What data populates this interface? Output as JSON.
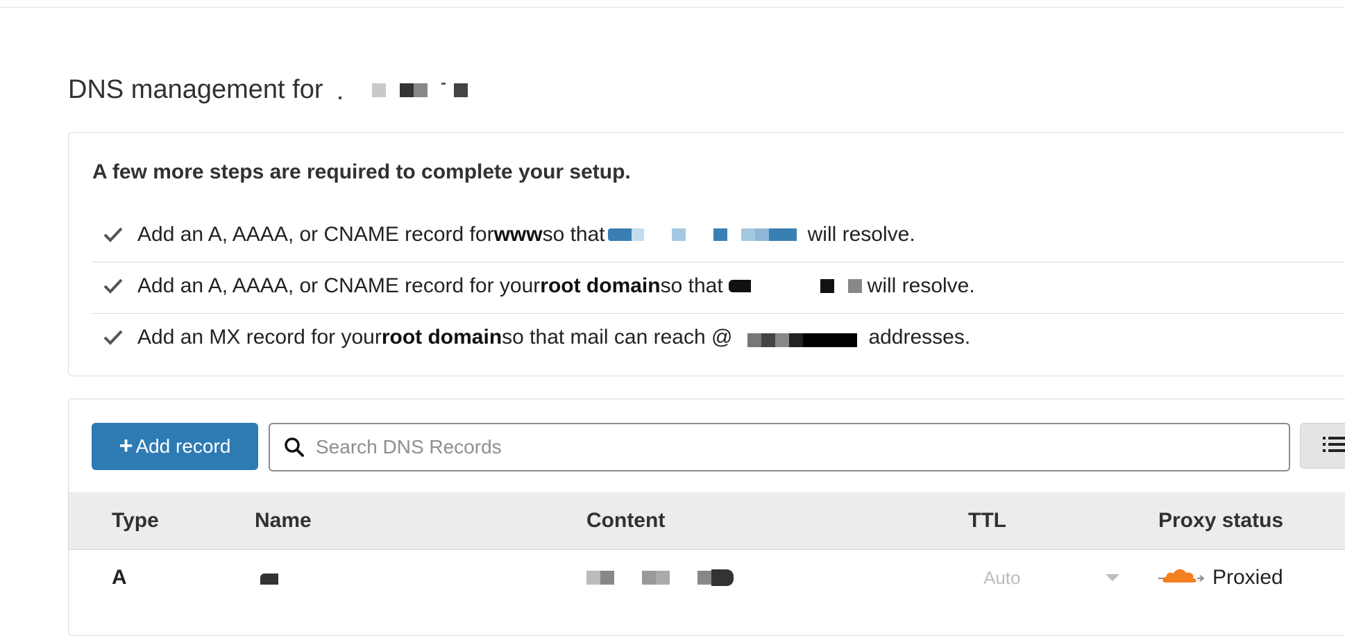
{
  "page": {
    "title": "DNS management for"
  },
  "setup": {
    "heading": "A few more steps are required to complete your setup.",
    "steps": [
      {
        "prefix": "Add an A, AAAA, or CNAME record for ",
        "bold": "www",
        "middle": " so that ",
        "suffix": " will resolve."
      },
      {
        "prefix": "Add an A, AAAA, or CNAME record for your ",
        "bold": "root domain",
        "middle": " so that ",
        "suffix": " will resolve."
      },
      {
        "prefix": "Add an MX record for your ",
        "bold": "root domain",
        "middle": " so that mail can reach @",
        "suffix": " addresses."
      }
    ]
  },
  "toolbar": {
    "add_record_label": "Add record",
    "add_record_icon": "plus-icon",
    "search_placeholder": "Search DNS Records",
    "search_value": "",
    "search_icon": "search-icon",
    "view_toggle_icon": "list-icon"
  },
  "table": {
    "columns": [
      "Type",
      "Name",
      "Content",
      "TTL",
      "Proxy status"
    ],
    "rows": [
      {
        "type": "A",
        "name": "",
        "content": "",
        "ttl": "Auto",
        "proxy_status": "Proxied"
      }
    ]
  },
  "colors": {
    "accent": "#2e7bb4",
    "cloud": "#f38020",
    "text": "#313131",
    "header_bg": "#ececec"
  }
}
